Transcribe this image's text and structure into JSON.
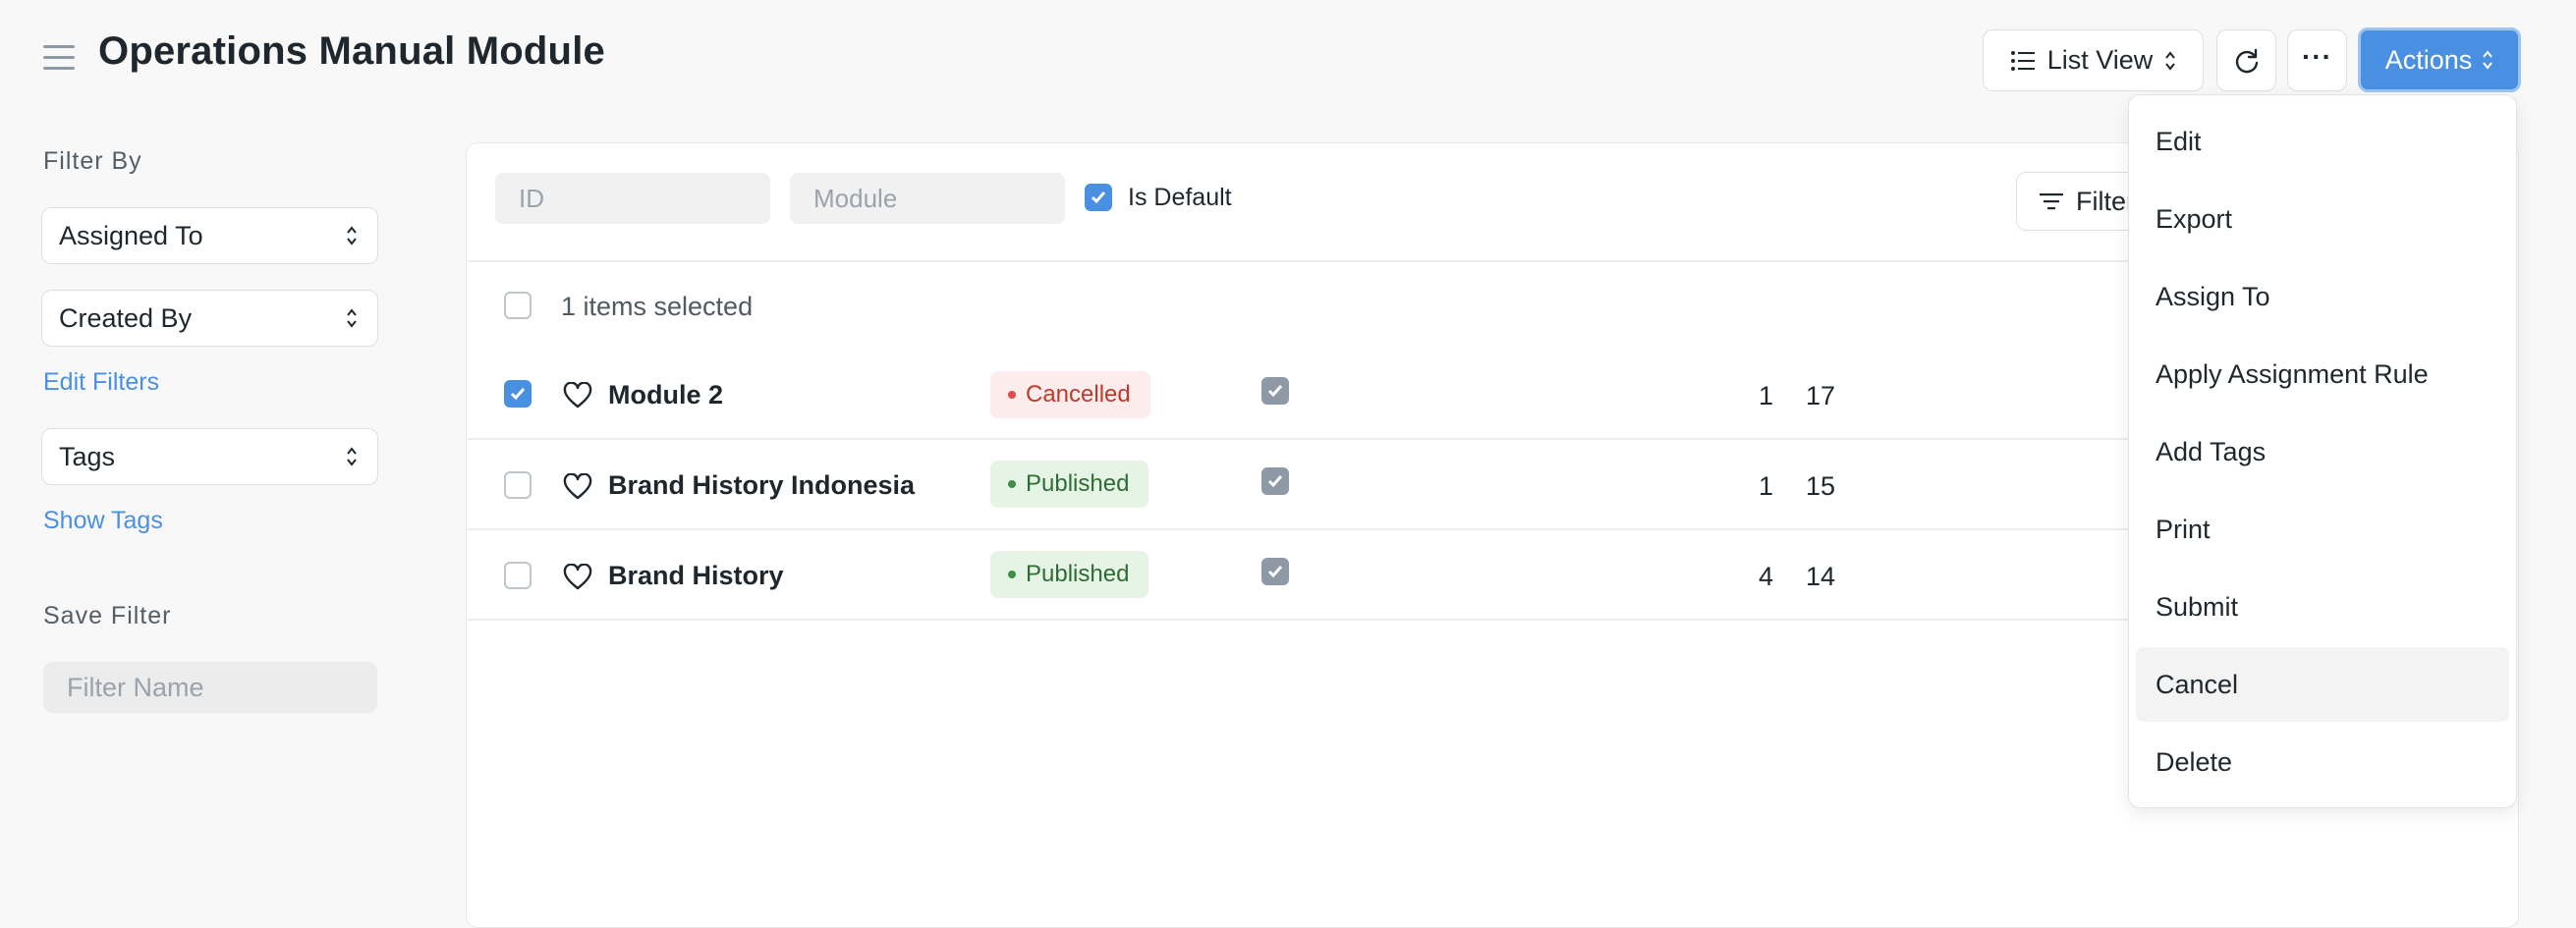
{
  "header": {
    "title": "Operations Manual Module",
    "list_view_label": "List View",
    "more_label": "···",
    "actions_label": "Actions"
  },
  "sidebar": {
    "filter_by_heading": "Filter By",
    "assigned_to": "Assigned To",
    "created_by": "Created By",
    "edit_filters": "Edit Filters",
    "tags": "Tags",
    "show_tags": "Show Tags",
    "save_filter_heading": "Save Filter",
    "filter_name_placeholder": "Filter Name"
  },
  "filters": {
    "id_placeholder": "ID",
    "module_placeholder": "Module",
    "is_default_label": "Is Default",
    "is_default_checked": true,
    "filter_button_label": "Filter"
  },
  "list": {
    "selected_text": "1 items selected",
    "rows": [
      {
        "title": "Module 2",
        "status": "Cancelled",
        "default": true,
        "count": "1",
        "comments": "17",
        "selected": true
      },
      {
        "title": "Brand History Indonesia",
        "status": "Published",
        "default": true,
        "count": "1",
        "comments": "15",
        "selected": false
      },
      {
        "title": "Brand History",
        "status": "Published",
        "default": true,
        "count": "4",
        "comments": "14",
        "selected": false
      }
    ]
  },
  "actions_menu": {
    "items": [
      "Edit",
      "Export",
      "Assign To",
      "Apply Assignment Rule",
      "Add Tags",
      "Print",
      "Submit",
      "Cancel",
      "Delete"
    ],
    "hovered": "Cancel"
  },
  "colors": {
    "primary": "#4a90e2",
    "cancelled_text": "#c0392b",
    "published_text": "#2f6b35"
  }
}
